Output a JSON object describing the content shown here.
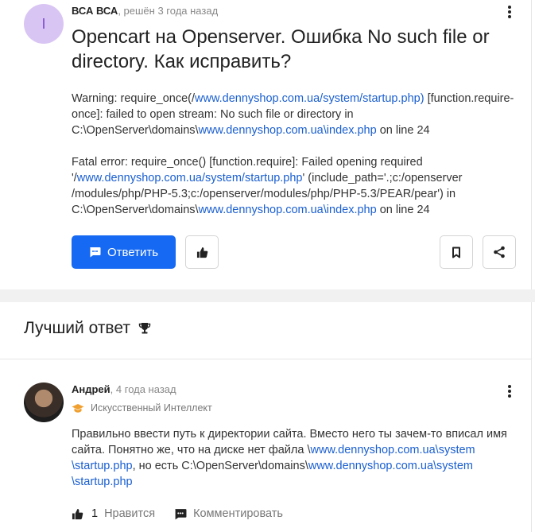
{
  "question": {
    "avatar_letter": "I",
    "author": "ВСА ВСА",
    "meta_separator": ", ",
    "time": "решён 3 года назад",
    "title": "Opencart на Openserver. Ошибка No such file or directory. Как исправить?",
    "body": {
      "p1": {
        "t1": "Warning: require_once(/",
        "link1": "www.dennyshop.com.ua/system/startup.php)",
        "t2": " [function.require-once]: failed to open stream: No such file or directory in C:\\OpenServer\\domains\\",
        "link2": "www.dennyshop.com.ua\\index.php",
        "t3": " on line 24"
      },
      "p2": {
        "t1": "Fatal error: require_once() [function.require]: Failed opening required '/",
        "link1": "www.dennyshop.com.ua/system/startup.php",
        "t2": "' (include_path='.;c:/openserver /modules/php/PHP-5.3;c:/openserver/modules/php/PHP-5.3/PEAR/pear') in C:\\OpenServer\\domains\\",
        "link2": "www.dennyshop.com.ua\\index.php",
        "t3": " on line 24"
      }
    },
    "reply_label": "Ответить"
  },
  "best_answer": {
    "heading": "Лучший ответ",
    "author": "Андрей",
    "meta_separator": ", ",
    "time": "4 года назад",
    "role": "Искусственный Интеллект",
    "body": {
      "t1": "Правильно ввести путь к директории сайта. Вместо него ты зачем-то вписал имя сайта. Понятно же, что на диске нет файла \\",
      "link1": "www.dennyshop.com.ua\\system \\startup.php",
      "t2": ", но есть C:\\OpenServer\\domains\\",
      "link2": "www.dennyshop.com.ua\\system \\startup.php"
    },
    "like_count": "1",
    "like_label": "Нравится",
    "comment_label": "Комментировать"
  },
  "colors": {
    "accent": "#1669f2",
    "link": "#1a5fd0",
    "avatar_bg": "#d9c5f3",
    "role_badge": "#f0a030"
  },
  "icons": [
    "more-vertical-icon",
    "chat-bubble-icon",
    "thumbs-up-icon",
    "bookmark-icon",
    "share-icon",
    "trophy-icon",
    "graduation-cap-icon"
  ]
}
